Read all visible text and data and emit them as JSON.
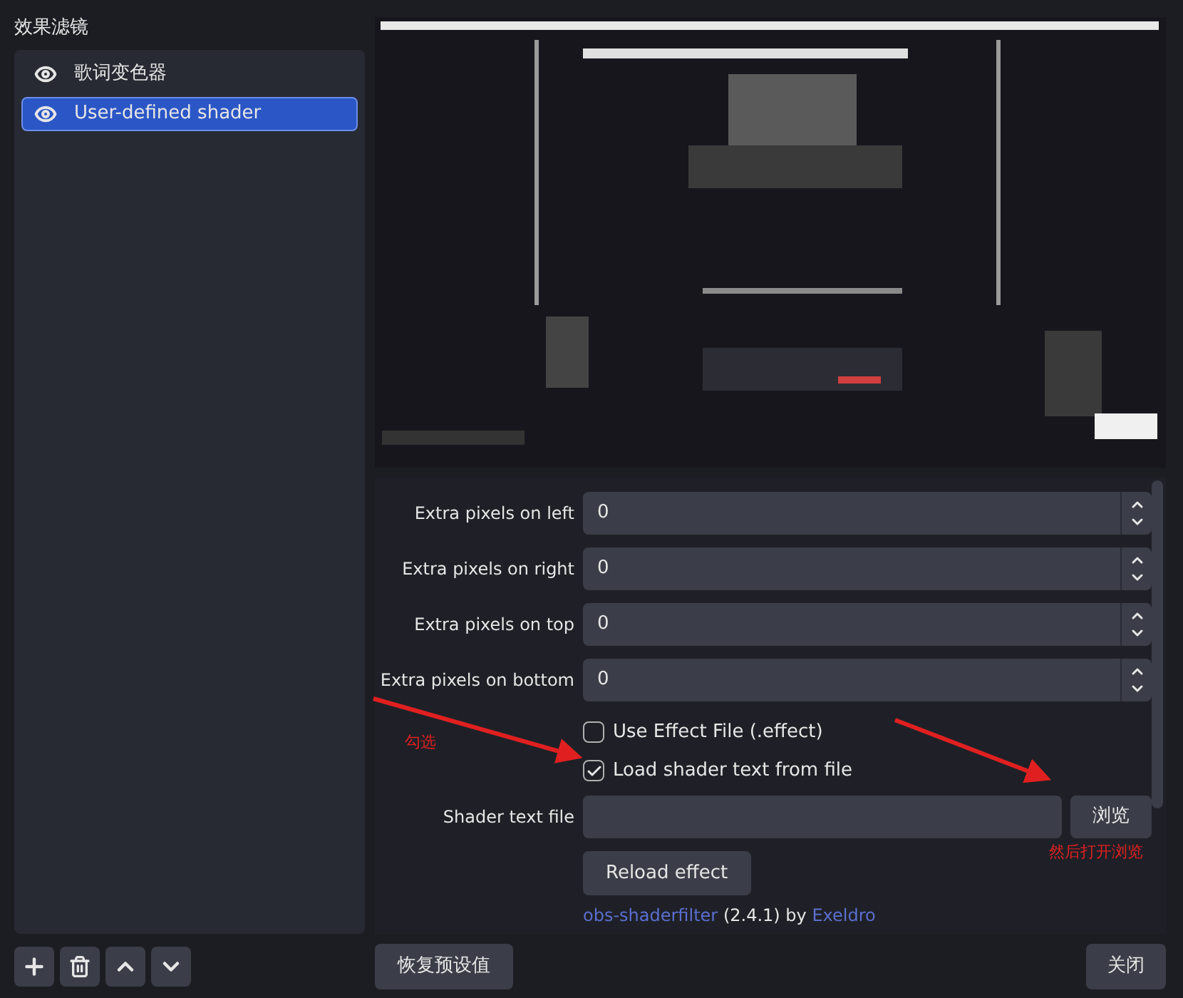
{
  "filters_panel": {
    "title": "效果滤镜",
    "items": [
      {
        "label": "歌词变色器",
        "selected": false,
        "visible": true
      },
      {
        "label": "User-defined shader",
        "selected": true,
        "visible": true
      }
    ]
  },
  "properties": {
    "spin_fields": [
      {
        "label": "Extra pixels on left",
        "value": "0"
      },
      {
        "label": "Extra pixels on right",
        "value": "0"
      },
      {
        "label": "Extra pixels on top",
        "value": "0"
      },
      {
        "label": "Extra pixels on bottom",
        "value": "0"
      }
    ],
    "checkboxes": [
      {
        "label": "Use Effect File (.effect)",
        "checked": false
      },
      {
        "label": "Load shader text from file",
        "checked": true
      }
    ],
    "file_field": {
      "label": "Shader text file",
      "browse": "浏览"
    },
    "reload_button": "Reload effect",
    "credit": {
      "link": "obs-shaderfilter",
      "version": "(2.4.1) by",
      "author": "Exeldro"
    }
  },
  "annotations": [
    "勾选",
    "然后打开浏览"
  ],
  "footer": {
    "reset_button": "恢复预设值",
    "close_button": "关闭"
  }
}
